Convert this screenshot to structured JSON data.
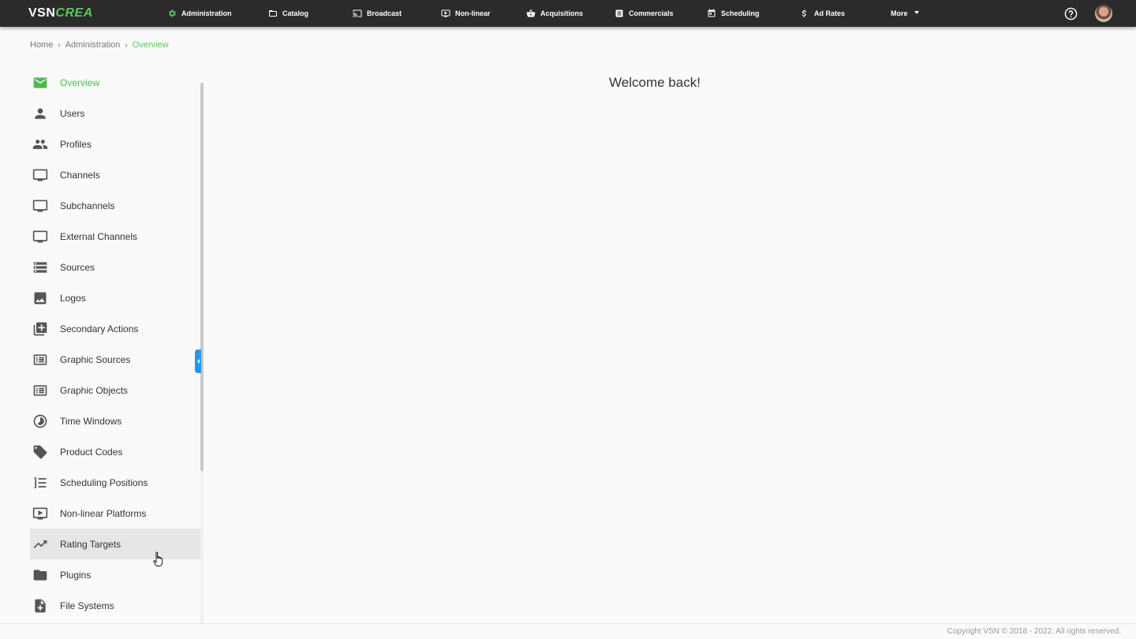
{
  "app": {
    "logo_primary": "VSN",
    "logo_secondary": "CREA"
  },
  "nav": {
    "items": [
      {
        "label": "Administration",
        "icon": "gear-icon"
      },
      {
        "label": "Catalog",
        "icon": "folder-icon"
      },
      {
        "label": "Broadcast",
        "icon": "cast-icon"
      },
      {
        "label": "Non-linear",
        "icon": "play-box-icon"
      },
      {
        "label": "Acquisitions",
        "icon": "basket-icon"
      },
      {
        "label": "Commercials",
        "icon": "list-icon"
      },
      {
        "label": "Scheduling",
        "icon": "calendar-icon"
      },
      {
        "label": "Ad Rates",
        "icon": "dollar-icon"
      },
      {
        "label": "More",
        "icon": "chevron-down-icon"
      }
    ],
    "help_icon": "help-circle-icon",
    "avatar": "user-avatar"
  },
  "breadcrumb": {
    "items": [
      "Home",
      "Administration",
      "Overview"
    ]
  },
  "sidebar": {
    "items": [
      {
        "label": "Overview",
        "icon": "mail-icon"
      },
      {
        "label": "Users",
        "icon": "person-icon"
      },
      {
        "label": "Profiles",
        "icon": "people-icon"
      },
      {
        "label": "Channels",
        "icon": "monitor-icon"
      },
      {
        "label": "Subchannels",
        "icon": "monitor-icon"
      },
      {
        "label": "External Channels",
        "icon": "monitor-icon"
      },
      {
        "label": "Sources",
        "icon": "storage-icon"
      },
      {
        "label": "Logos",
        "icon": "image-icon"
      },
      {
        "label": "Secondary Actions",
        "icon": "library-icon"
      },
      {
        "label": "Graphic Sources",
        "icon": "subtitles-icon"
      },
      {
        "label": "Graphic Objects",
        "icon": "subtitles-icon"
      },
      {
        "label": "Time Windows",
        "icon": "timelapse-icon"
      },
      {
        "label": "Product Codes",
        "icon": "tag-icon"
      },
      {
        "label": "Scheduling Positions",
        "icon": "ordered-list-icon"
      },
      {
        "label": "Non-linear Platforms",
        "icon": "play-box-icon"
      },
      {
        "label": "Rating Targets",
        "icon": "trending-up-icon"
      },
      {
        "label": "Plugins",
        "icon": "folder-icon"
      },
      {
        "label": "File Systems",
        "icon": "file-add-icon"
      }
    ],
    "active_item": "Overview",
    "hovered_item": "Rating Targets"
  },
  "main": {
    "welcome": "Welcome back!"
  },
  "footer": {
    "copyright": "Copyright VSN © 2018 - 2022. All rights reserved."
  },
  "colors": {
    "accent": "#4cbb4c",
    "topbar": "#2b2b2b",
    "handle": "#2196f3"
  }
}
